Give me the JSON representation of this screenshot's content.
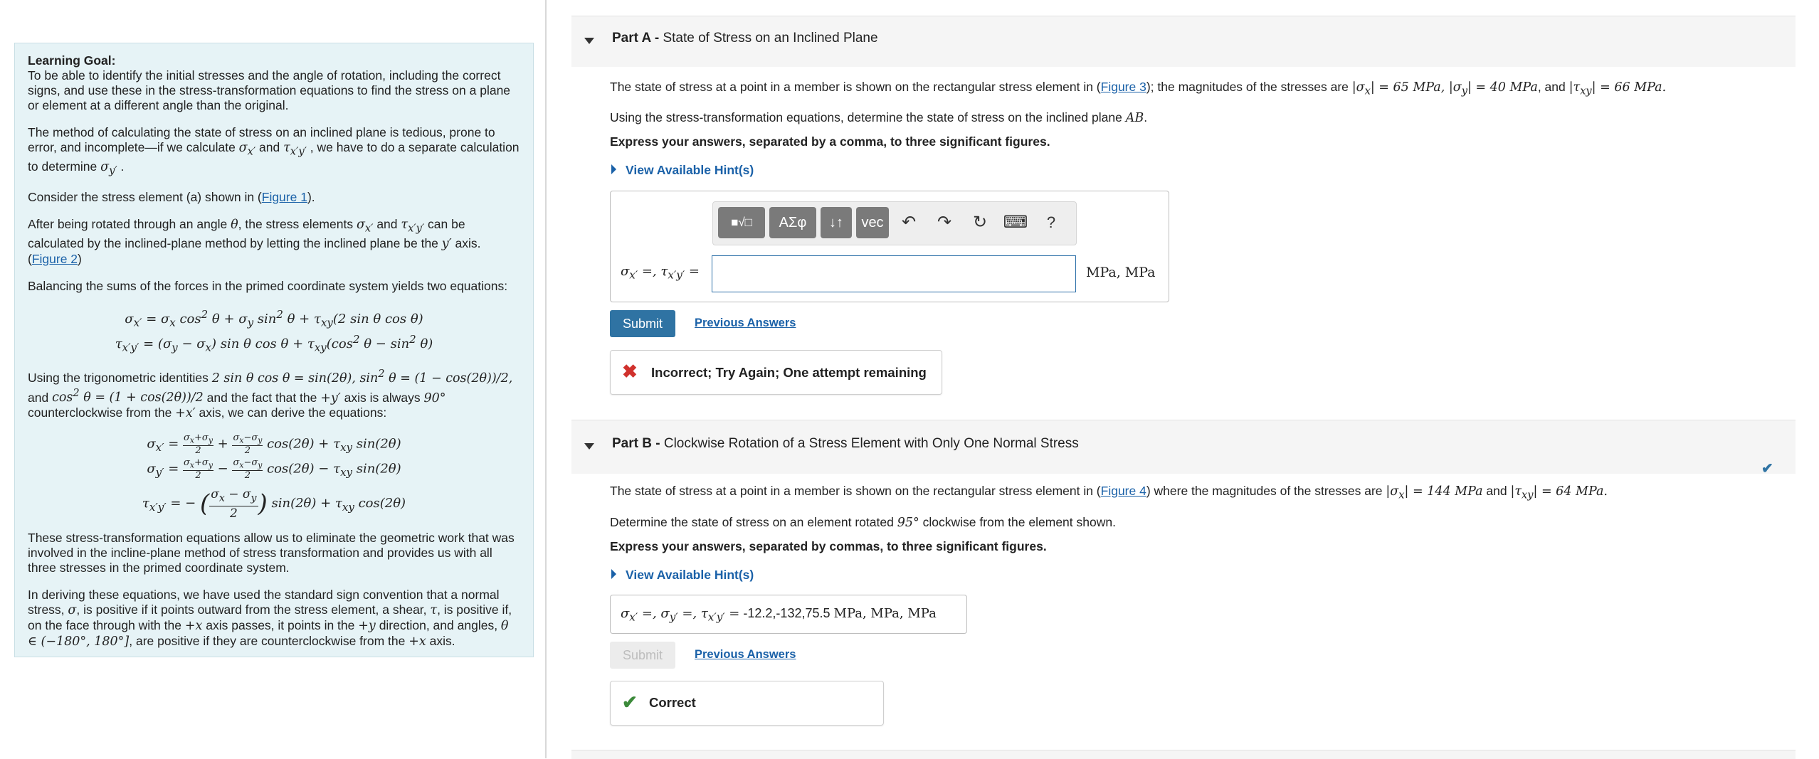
{
  "left": {
    "goal_title": "Learning Goal:",
    "goal_text": "To be able to identify the initial stresses and the angle of rotation, including the correct signs, and use these in the stress-transformation equations to find the stress on a plane or element at a different angle than the original.",
    "p1_a": "The method of calculating the state of stress on an inclined plane is tedious, prone to error, and incomplete—if we calculate ",
    "p1_b": " and ",
    "p1_c": " , we have to do a separate calculation to determine ",
    "p2_a": "Consider the stress element (a) shown in (",
    "p2_link": "Figure 1",
    "p2_b": ").",
    "p3_a": "After being rotated through an angle ",
    "p3_b": ", the stress elements ",
    "p3_c": " and ",
    "p3_d": " can be calculated by the inclined-plane method by letting the inclined plane be the ",
    "p3_e": " axis.",
    "p3_link": "Figure 2",
    "p4": "Balancing the sums of the forces in the primed coordinate system yields two equations:",
    "p5_a": "Using the trigonometric identities ",
    "p5_b": " and the fact that the ",
    "p5_c": " axis is always ",
    "p5_d": " counterclockwise from the ",
    "p5_e": " axis, we can derive the equations:",
    "p6": "These stress-transformation equations allow us to eliminate the geometric work that was involved in the incline-plane method of stress transformation and provides us with all three stresses in the primed coordinate system.",
    "p7_a": "In deriving these equations, we have used the standard sign convention that a normal stress, ",
    "p7_b": ", is positive if it points outward from the stress element, a shear, ",
    "p7_c": ", is positive if, on the face through with the ",
    "p7_d": " axis passes, it points in the ",
    "p7_e": " direction, and angles, ",
    "p7_f": ", are positive if they are counterclockwise from the ",
    "p7_g": " axis."
  },
  "partA": {
    "label": "Part A -",
    "title": "State of Stress on an Inclined Plane",
    "stmt_a": "The state of stress at a point in a member is shown on the rectangular stress element in (",
    "stmt_link": "Figure 3",
    "stmt_b": "); the magnitudes of the stresses are ",
    "sx": "65",
    "sy": "40",
    "txy": "66",
    "stmt2_a": "Using the stress-transformation equations, determine the state of stress on the inclined plane ",
    "stmt2_plane": "AB",
    "instruction": "Express your answers, separated by a comma, to three significant figures.",
    "hint_label": "View Available Hint(s)",
    "toolbar": {
      "templates": "■√□",
      "greek": "AΣφ",
      "arrows": "↓↑",
      "vec": "vec",
      "undo": "↶",
      "redo": "↷",
      "reset": "↻",
      "keyboard": "⌨",
      "help": "?"
    },
    "input_value": "",
    "units": "MPa, MPa",
    "submit_label": "Submit",
    "prev_label": "Previous Answers",
    "feedback_icon": "✖",
    "feedback": "Incorrect; Try Again; One attempt remaining",
    "color_error": "#d0312d"
  },
  "partB": {
    "label": "Part B -",
    "title": "Clockwise Rotation of a Stress Element with Only One Normal Stress",
    "stmt_a": "The state of stress at a point in a member is shown on the rectangular stress element in (",
    "stmt_link": "Figure 4",
    "stmt_b": ") where the magnitudes of the stresses are ",
    "sx": "144",
    "txy": "64",
    "stmt2_a": "Determine the state of stress on an element rotated ",
    "angle": "95",
    "stmt2_b": " clockwise from the element shown.",
    "instruction": "Express your answers, separated by commas, to three significant figures.",
    "hint_label": "View Available Hint(s)",
    "answer_value": "-12.2,-132,75.5",
    "units": "MPa, MPa, MPa",
    "submit_label": "Submit",
    "prev_label": "Previous Answers",
    "feedback_icon": "✔",
    "feedback": "Correct",
    "color_ok": "#3c8a3a",
    "complete_icon": "✔"
  }
}
